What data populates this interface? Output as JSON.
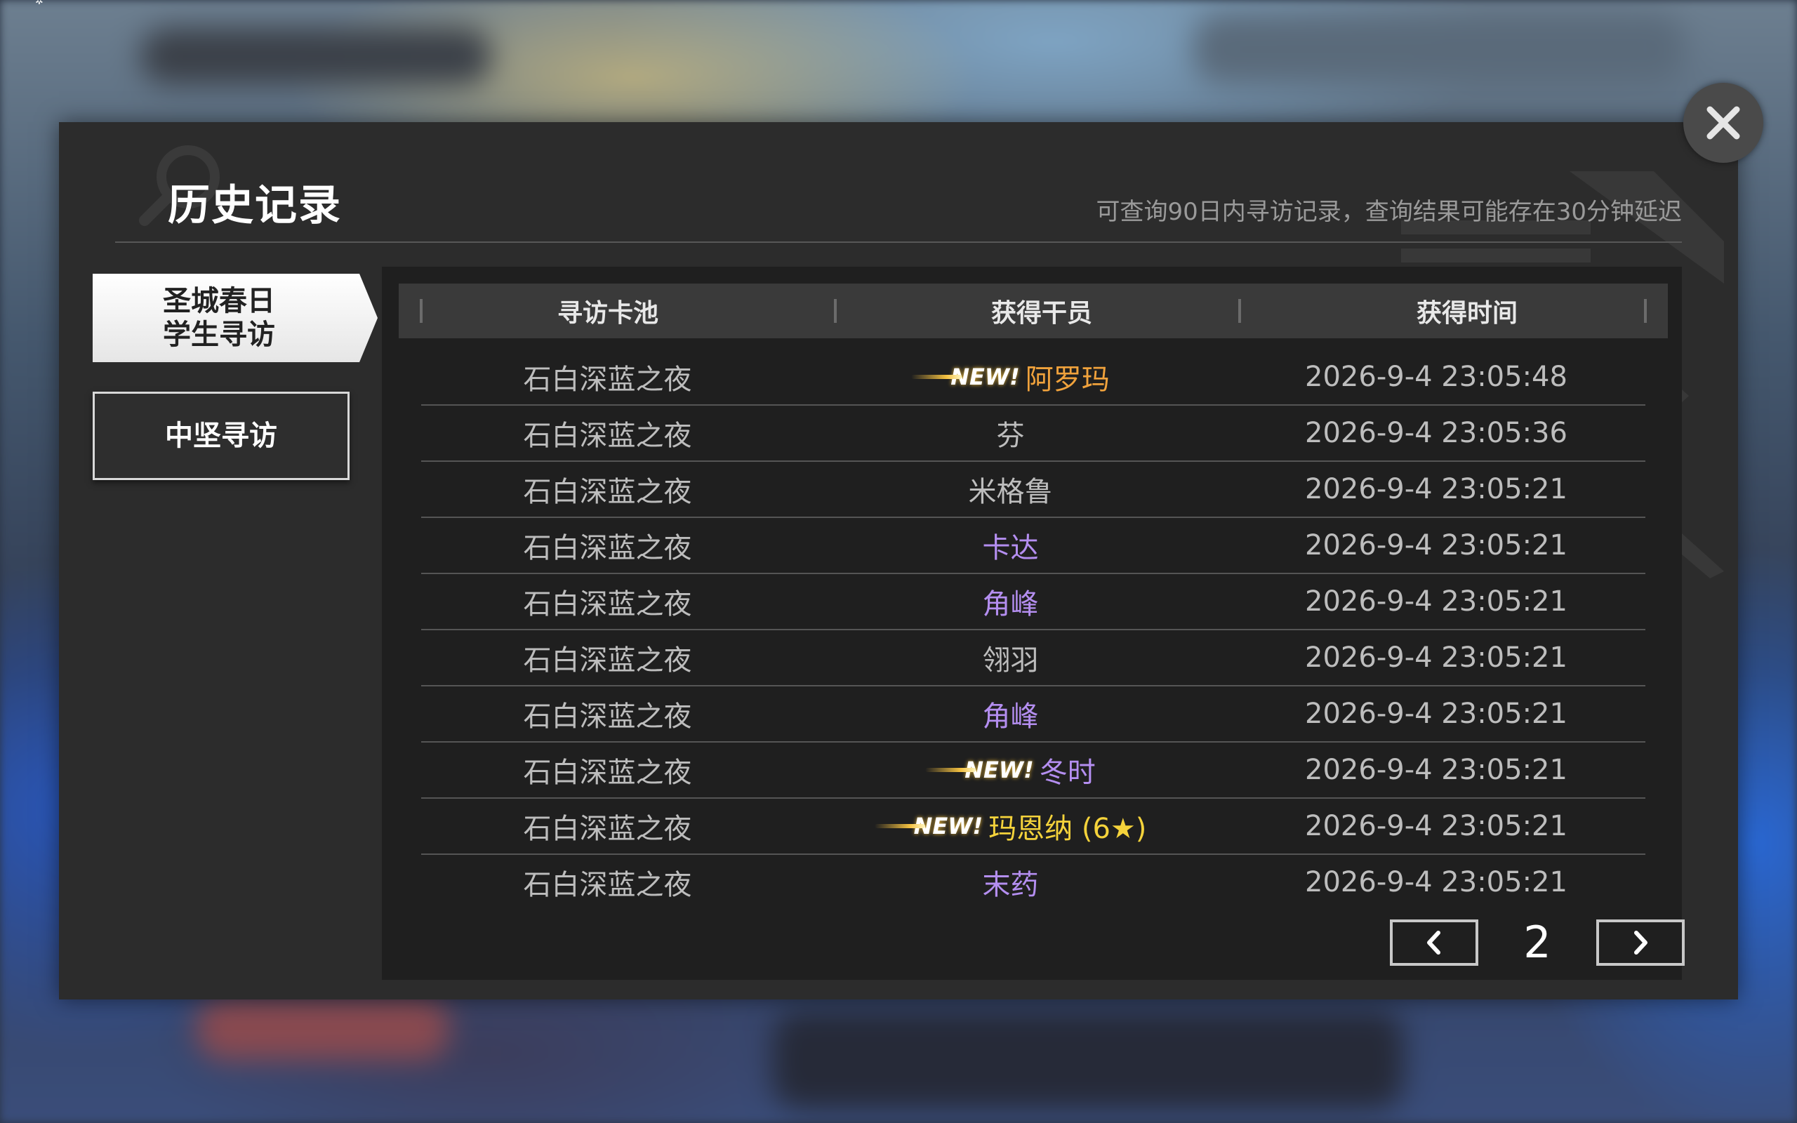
{
  "dialog": {
    "title": "历史记录",
    "hint": "可查询90日内寻访记录，查询结果可能存在30分钟延迟"
  },
  "tabs": [
    {
      "label": "圣城春日\n学生寻访",
      "active": true
    },
    {
      "label": "中坚寻访",
      "active": false
    }
  ],
  "table": {
    "headers": [
      "寻访卡池",
      "获得干员",
      "获得时间"
    ],
    "rows": [
      {
        "pool": "石白深蓝之夜",
        "new_badge": "NEW!",
        "operator": "阿罗玛",
        "color": "#f0a23c",
        "time": "2026-9-4 23:05:48"
      },
      {
        "pool": "石白深蓝之夜",
        "new_badge": "",
        "operator": "芬",
        "color": "#bdbdbd",
        "time": "2026-9-4 23:05:36"
      },
      {
        "pool": "石白深蓝之夜",
        "new_badge": "",
        "operator": "米格鲁",
        "color": "#bdbdbd",
        "time": "2026-9-4 23:05:21"
      },
      {
        "pool": "石白深蓝之夜",
        "new_badge": "",
        "operator": "卡达",
        "color": "#b48ef0",
        "time": "2026-9-4 23:05:21"
      },
      {
        "pool": "石白深蓝之夜",
        "new_badge": "",
        "operator": "角峰",
        "color": "#b48ef0",
        "time": "2026-9-4 23:05:21"
      },
      {
        "pool": "石白深蓝之夜",
        "new_badge": "",
        "operator": "翎羽",
        "color": "#bdbdbd",
        "time": "2026-9-4 23:05:21"
      },
      {
        "pool": "石白深蓝之夜",
        "new_badge": "",
        "operator": "角峰",
        "color": "#b48ef0",
        "time": "2026-9-4 23:05:21"
      },
      {
        "pool": "石白深蓝之夜",
        "new_badge": "NEW!",
        "operator": "冬时",
        "color": "#b48ef0",
        "time": "2026-9-4 23:05:21"
      },
      {
        "pool": "石白深蓝之夜",
        "new_badge": "NEW!",
        "operator": "玛恩纳 (6★)",
        "color": "#f5d33b",
        "time": "2026-9-4 23:05:21"
      },
      {
        "pool": "石白深蓝之夜",
        "new_badge": "",
        "operator": "末药",
        "color": "#b48ef0",
        "time": "2026-9-4 23:05:21"
      }
    ]
  },
  "pager": {
    "page": "2",
    "prev_icon": "chevron-left-icon",
    "next_icon": "chevron-right-icon"
  },
  "close_icon": "close-icon",
  "colors": {
    "dialog_bg": "#2c2c2c",
    "panel_bg": "#1f1f1f",
    "header_bg": "#3a3a3a",
    "rarity_orange": "#f0a23c",
    "rarity_purple": "#b48ef0",
    "rarity_yellow": "#f5d33b"
  }
}
